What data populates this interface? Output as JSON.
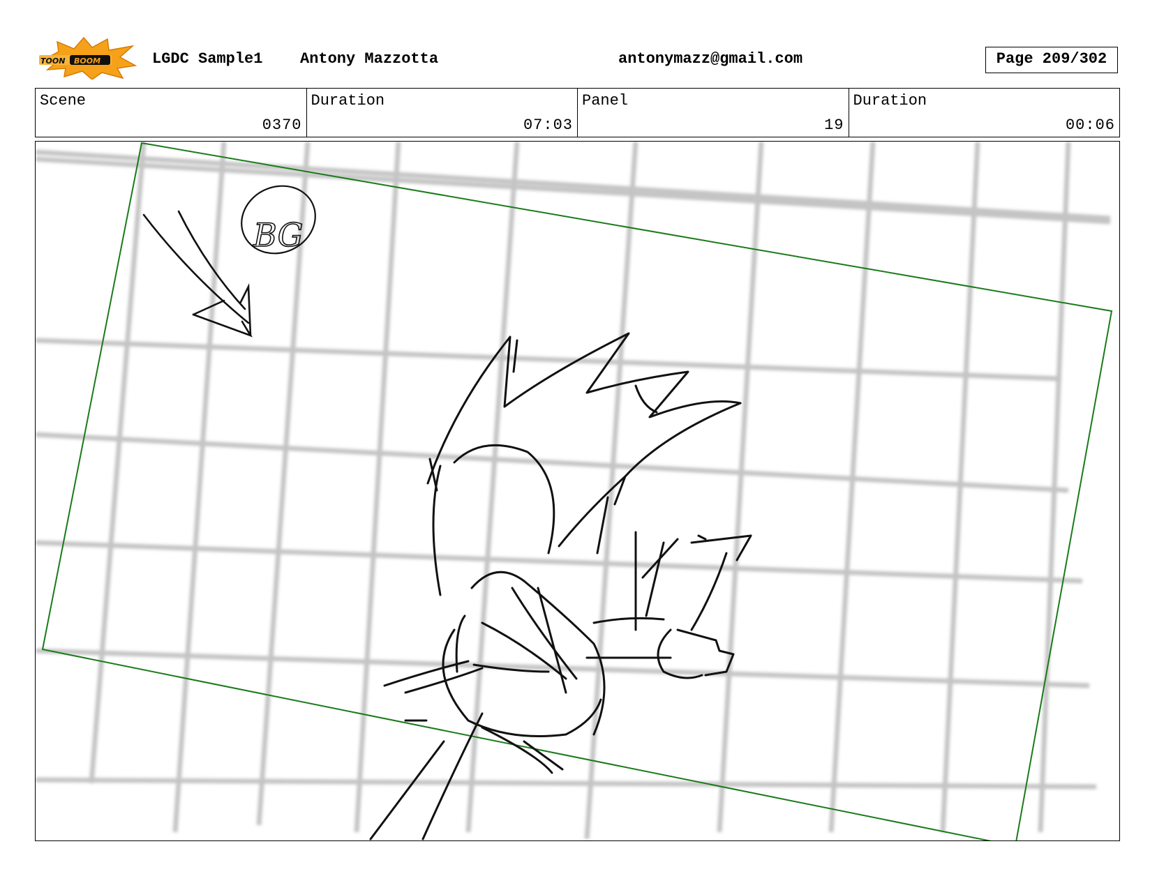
{
  "header": {
    "logo_text": "TOONBOOM",
    "project": "LGDC Sample1",
    "author": "Antony Mazzotta",
    "email": "antonymazz@gmail.com",
    "page": "Page 209/302"
  },
  "info": {
    "scene_label": "Scene",
    "scene_value": "0370",
    "duration_label": "Duration",
    "duration_value": "07:03",
    "panel_label": "Panel",
    "panel_value": "19",
    "panel_duration_label": "Duration",
    "panel_duration_value": "00:06"
  },
  "sketch": {
    "annotation": "BG",
    "frame_color": "#1a7a1a",
    "grid_color": "#c8c8c8",
    "logo_colors": {
      "burst": "#f5a21a",
      "text_bg": "#111111"
    }
  }
}
